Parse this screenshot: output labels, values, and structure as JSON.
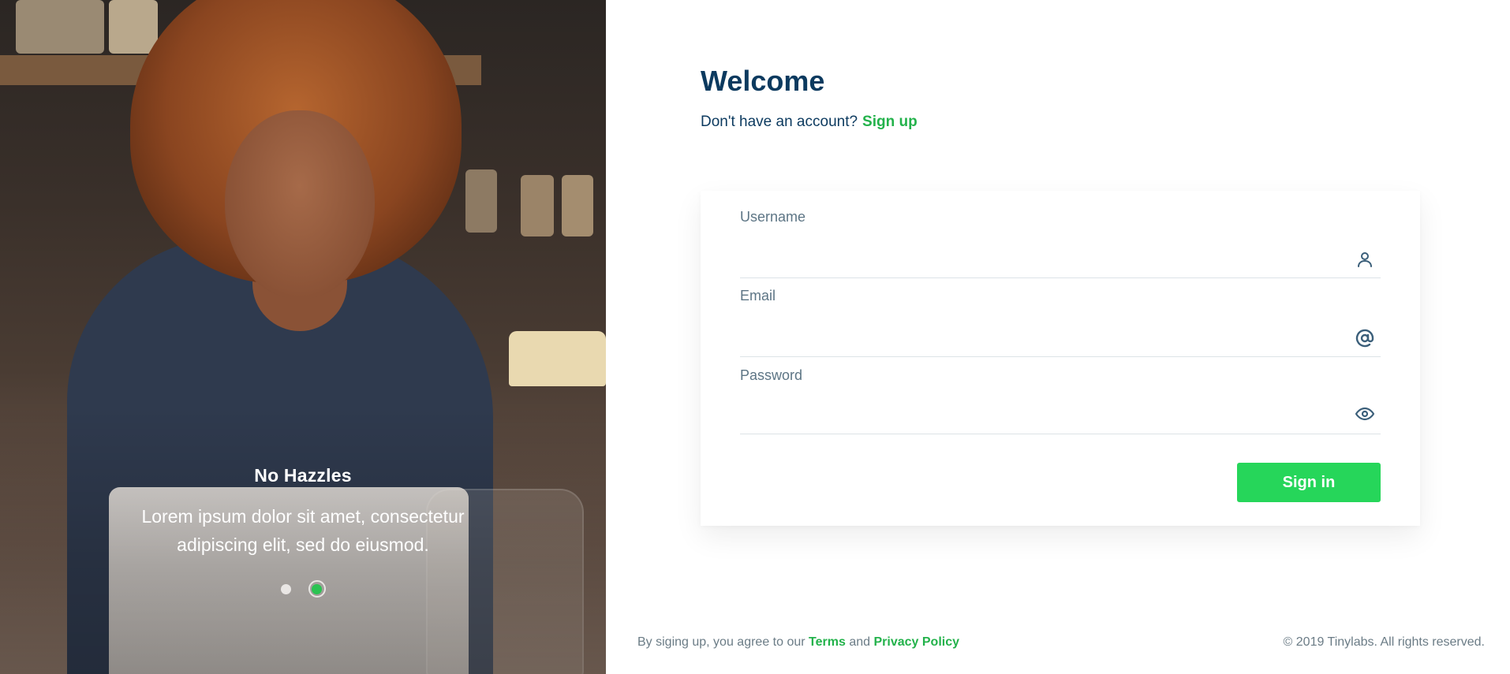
{
  "hero": {
    "slide_title": "No Hazzles",
    "slide_text": "Lorem ipsum dolor sit amet, consectetur adipiscing elit, sed do eiusmod.",
    "dots": [
      "slide-1",
      "slide-2"
    ],
    "active_dot": 2,
    "accent": "#2bc352"
  },
  "header": {
    "title": "Welcome",
    "prompt": "Don't have an account?",
    "signup_link": "Sign up"
  },
  "form": {
    "username_label": "Username",
    "username_value": "",
    "username_icon": "user-icon",
    "email_label": "Email",
    "email_value": "",
    "email_icon": "at-icon",
    "password_label": "Password",
    "password_value": "",
    "password_icon": "eye-icon",
    "submit_label": "Sign in",
    "submit_color": "#26d65a"
  },
  "footer": {
    "agree_prefix": "By siging up, you agree to our",
    "terms": "Terms",
    "and": "and",
    "privacy": "Privacy Policy",
    "copyright": "© 2019 Tinylabs. All rights reserved."
  },
  "colors": {
    "primary_text": "#0c3a5f",
    "link_green": "#23b24b",
    "muted": "#6b7c86"
  }
}
